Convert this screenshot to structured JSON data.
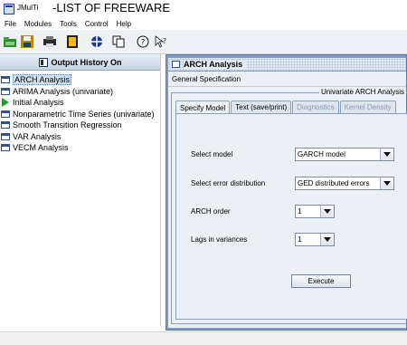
{
  "caption": {
    "app_name": "JMulTi",
    "title": "-LIST OF FREEWARE"
  },
  "menubar": [
    "File",
    "Modules",
    "Tools",
    "Control",
    "Help"
  ],
  "toolbar": {
    "icons": [
      "open-folder-icon",
      "save-icon",
      "print-icon",
      "clear-icon",
      "globe-icon",
      "copy-icon",
      "help-icon",
      "context-help-icon"
    ]
  },
  "history": {
    "title": "Output History On",
    "items": [
      {
        "label": "ARCH Analysis",
        "icon": "window-icon",
        "selected": true
      },
      {
        "label": "ARIMA Analysis (univariate)",
        "icon": "window-icon"
      },
      {
        "label": "Initial Analysis",
        "icon": "play-icon"
      },
      {
        "label": "Nonparametric Time Series (univariate)",
        "icon": "window-icon"
      },
      {
        "label": "Smooth Transition Regression",
        "icon": "window-icon"
      },
      {
        "label": "VAR Analysis",
        "icon": "window-icon"
      },
      {
        "label": "VECM Analysis",
        "icon": "window-icon"
      }
    ]
  },
  "frame": {
    "title": "ARCH Analysis",
    "general_spec": "General Specification",
    "group_title": "Univariate ARCH Analysis",
    "tabs": [
      {
        "label": "Specify Model",
        "active": true
      },
      {
        "label": "Text (save/print)"
      },
      {
        "label": "Diagnostics",
        "disabled": true
      },
      {
        "label": "Kernel Density",
        "disabled": true
      }
    ],
    "fields": {
      "model_label": "Select model",
      "model_value": "GARCH model",
      "dist_label": "Select error distribution",
      "dist_value": "GED distributed errors",
      "arch_label": "ARCH order",
      "arch_value": "1",
      "lags_label": "Lags in variances",
      "lags_value": "1"
    },
    "execute_label": "Execute"
  },
  "colors": {
    "frame_border": "#7f9bc6",
    "panel_bg": "#eceff3",
    "selection": "#cfe0f2"
  }
}
